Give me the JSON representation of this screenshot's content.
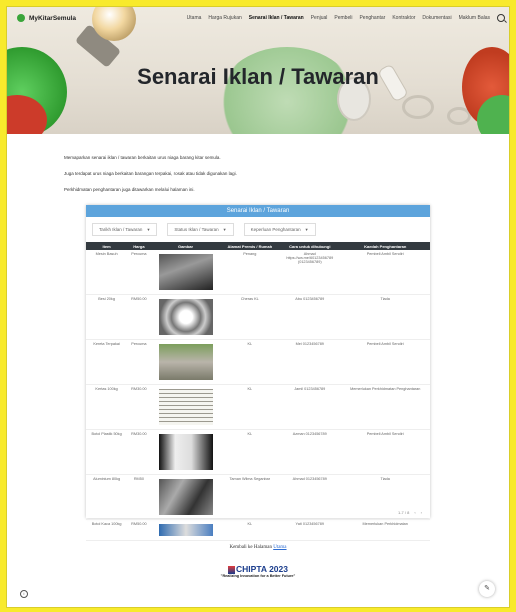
{
  "nav": {
    "brand": "MyKitarSemula",
    "items": [
      "Utama",
      "Harga Rujukan",
      "Senarai Iklan / Tawaran",
      "Penjual",
      "Pembeli",
      "Penghantar",
      "Kontraktor",
      "Dokumentasi",
      "Maklum Balas"
    ],
    "active_index": 2
  },
  "hero": {
    "title": "Senarai Iklan / Tawaran"
  },
  "intro": [
    "Memaparkan senarai iklan / tawaran berkaitan urus niaga barang kitar semula.",
    "Juga terdapat urus niaga berkaitan barangan terpakai, rosak atau tidak digunakan lagi.",
    "Perkhidmatan penghantaran juga ditawarkan melalui halaman ini."
  ],
  "table_card": {
    "title": "Senarai Iklan / Tawaran",
    "filters": [
      "Tarikh Iklan / Tawaran",
      "Status Iklan / Tawaran",
      "Keperluan Penghantaran"
    ],
    "columns": [
      "Item",
      "Harga",
      "Gambar",
      "Alamat Premis / Rumah",
      "Cara untuk dihubungi",
      "Kaedah Penghantaran"
    ],
    "rows": [
      [
        "Mesin Basuh",
        "Percuma",
        "washing-machine",
        "Penang",
        "Ahmad\nhttps://wa.me/60123456789\n(0123456789)",
        "Pembeli Ambil Sendiri"
      ],
      [
        "Besi 20kg",
        "RM50.00",
        "steel-wire",
        "Cheras KL",
        "Abu 0123456789",
        "Tiada"
      ],
      [
        "Kereta Terpakai",
        "Percuma",
        "used-car",
        "KL",
        "Mei 0123456789",
        "Pembeli Ambil Sendiri"
      ],
      [
        "Kertas 100kg",
        "RM30.00",
        "paper-stack",
        "KL",
        "Jamil 0123456789",
        "Memerlukan Perkhidmatan Penghantaran"
      ],
      [
        "Botol Plastik 50kg",
        "RM30.00",
        "plastic-bottles",
        "KL",
        "Azman 0123456789",
        "Pembeli Ambil Sendiri"
      ],
      [
        "Aluminium 80kg",
        "RM50",
        "aluminium-scrap",
        "Taman Wilma Seganbar",
        "Ahmad 0123456789",
        "Tiada"
      ],
      [
        "Botol Kaca 100kg",
        "RM50.00",
        "glass-bottles",
        "KL",
        "Yati 0123456789",
        "Memerlukan Perkhidmatan"
      ]
    ],
    "pagination": "1-7 / 8"
  },
  "footer": {
    "back_text": "Kembali ke Halaman",
    "back_link": "Utama",
    "chipta_logo": "CHIPTA 2023",
    "chipta_tagline": "\"Realizing Innovation for a Better Future\""
  },
  "colors": {
    "page_border": "#f8ea2c",
    "table_header": "#5da4dc",
    "column_header": "#333a40"
  }
}
